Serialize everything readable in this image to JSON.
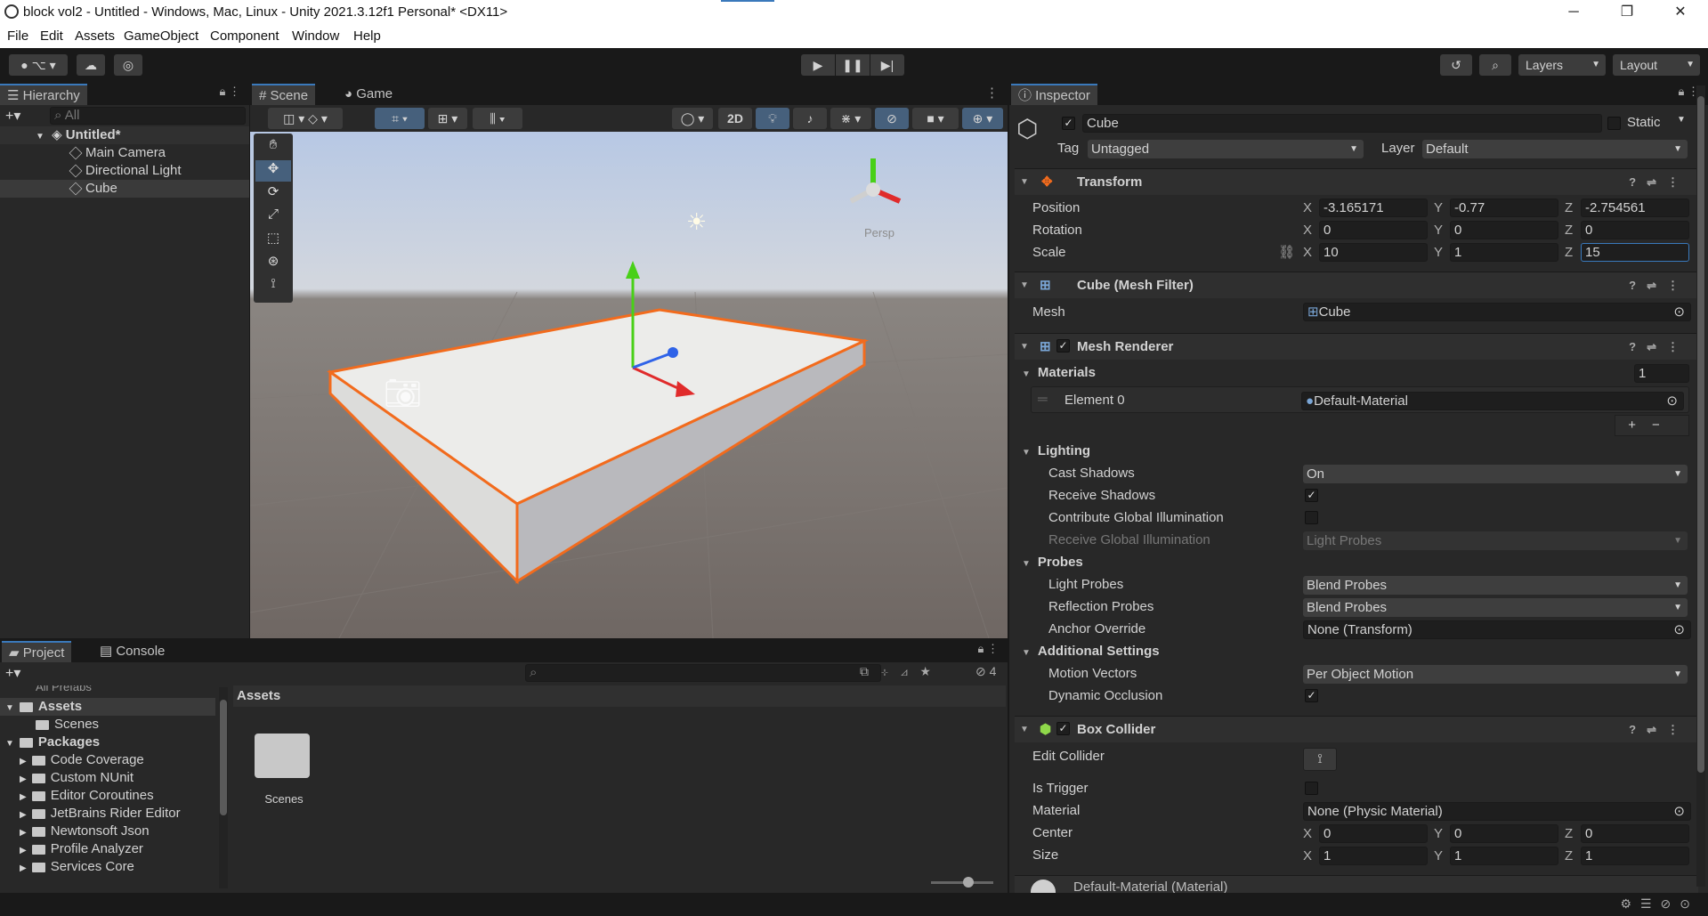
{
  "window": {
    "title": "block vol2 - Untitled - Windows, Mac, Linux - Unity 2021.3.12f1 Personal* <DX11>",
    "minimize": "─",
    "maximize": "❐",
    "close": "✕"
  },
  "menu": [
    "File",
    "Edit",
    "Assets",
    "GameObject",
    "Component",
    "Window",
    "Help"
  ],
  "toolbar": {
    "layers_label": "Layers",
    "layout_label": "Layout"
  },
  "hierarchy": {
    "tab": "Hierarchy",
    "search_placeholder": "All",
    "scene": "Untitled*",
    "items": [
      "Main Camera",
      "Directional Light",
      "Cube"
    ]
  },
  "scene_view": {
    "tabs": [
      "Scene",
      "Game"
    ],
    "mode_2d": "2D",
    "persp_label": "Persp"
  },
  "project": {
    "tabs": [
      "Project",
      "Console"
    ],
    "hidden_count": "4",
    "tree_partial": "All Prefabs",
    "tree": {
      "assets": "Assets",
      "assets_children": [
        "Scenes"
      ],
      "packages": "Packages",
      "packages_children": [
        "Code Coverage",
        "Custom NUnit",
        "Editor Coroutines",
        "JetBrains Rider Editor",
        "Newtonsoft Json",
        "Profile Analyzer",
        "Services Core"
      ]
    },
    "breadcrumb": "Assets",
    "grid_items": [
      "Scenes"
    ]
  },
  "inspector": {
    "tab": "Inspector",
    "object_name": "Cube",
    "static_label": "Static",
    "tag_label": "Tag",
    "tag_value": "Untagged",
    "layer_label": "Layer",
    "layer_value": "Default",
    "transform": {
      "title": "Transform",
      "position_label": "Position",
      "position": {
        "x": "-3.165171",
        "y": "-0.77",
        "z": "-2.754561"
      },
      "rotation_label": "Rotation",
      "rotation": {
        "x": "0",
        "y": "0",
        "z": "0"
      },
      "scale_label": "Scale",
      "scale": {
        "x": "10",
        "y": "1",
        "z": "15"
      }
    },
    "mesh_filter": {
      "title": "Cube (Mesh Filter)",
      "mesh_label": "Mesh",
      "mesh_value": "Cube"
    },
    "mesh_renderer": {
      "title": "Mesh Renderer",
      "materials_label": "Materials",
      "materials_count": "1",
      "element0_label": "Element 0",
      "element0_value": "Default-Material",
      "lighting_label": "Lighting",
      "cast_shadows_label": "Cast Shadows",
      "cast_shadows_value": "On",
      "receive_shadows_label": "Receive Shadows",
      "contribute_gi_label": "Contribute Global Illumination",
      "receive_gi_label": "Receive Global Illumination",
      "receive_gi_value": "Light Probes",
      "probes_label": "Probes",
      "light_probes_label": "Light Probes",
      "light_probes_value": "Blend Probes",
      "reflection_probes_label": "Reflection Probes",
      "reflection_probes_value": "Blend Probes",
      "anchor_override_label": "Anchor Override",
      "anchor_override_value": "None (Transform)",
      "additional_label": "Additional Settings",
      "motion_vectors_label": "Motion Vectors",
      "motion_vectors_value": "Per Object Motion",
      "dynamic_occlusion_label": "Dynamic Occlusion"
    },
    "box_collider": {
      "title": "Box Collider",
      "edit_label": "Edit Collider",
      "is_trigger_label": "Is Trigger",
      "material_label": "Material",
      "material_value": "None (Physic Material)",
      "center_label": "Center",
      "center": {
        "x": "0",
        "y": "0",
        "z": "0"
      },
      "size_label": "Size",
      "size": {
        "x": "1",
        "y": "1",
        "z": "1"
      }
    },
    "material_footer": "Default-Material (Material)"
  },
  "colors": {
    "selection_outline": "#f26b1d",
    "accent": "#3a79bb",
    "panel_bg": "#282828"
  }
}
